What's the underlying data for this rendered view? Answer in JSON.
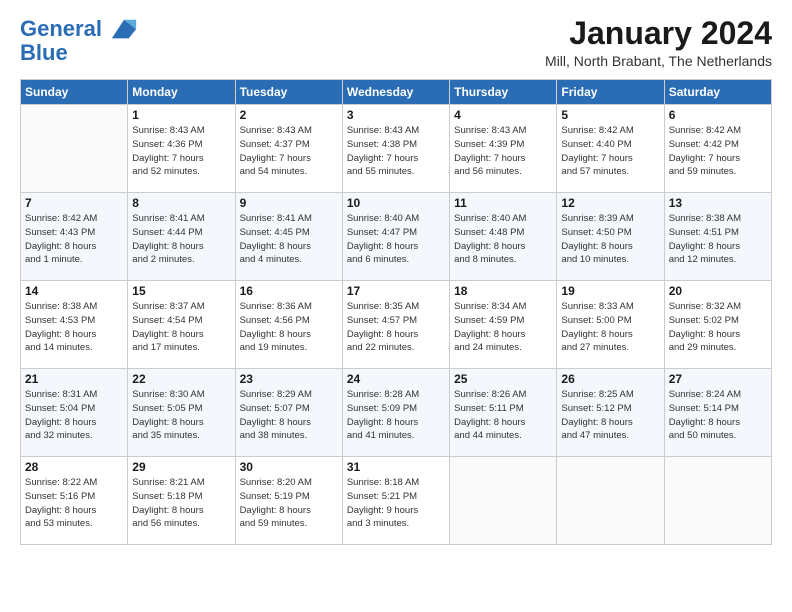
{
  "header": {
    "logo_line1": "General",
    "logo_line2": "Blue",
    "month": "January 2024",
    "location": "Mill, North Brabant, The Netherlands"
  },
  "days_of_week": [
    "Sunday",
    "Monday",
    "Tuesday",
    "Wednesday",
    "Thursday",
    "Friday",
    "Saturday"
  ],
  "weeks": [
    [
      {
        "day": "",
        "info": ""
      },
      {
        "day": "1",
        "info": "Sunrise: 8:43 AM\nSunset: 4:36 PM\nDaylight: 7 hours\nand 52 minutes."
      },
      {
        "day": "2",
        "info": "Sunrise: 8:43 AM\nSunset: 4:37 PM\nDaylight: 7 hours\nand 54 minutes."
      },
      {
        "day": "3",
        "info": "Sunrise: 8:43 AM\nSunset: 4:38 PM\nDaylight: 7 hours\nand 55 minutes."
      },
      {
        "day": "4",
        "info": "Sunrise: 8:43 AM\nSunset: 4:39 PM\nDaylight: 7 hours\nand 56 minutes."
      },
      {
        "day": "5",
        "info": "Sunrise: 8:42 AM\nSunset: 4:40 PM\nDaylight: 7 hours\nand 57 minutes."
      },
      {
        "day": "6",
        "info": "Sunrise: 8:42 AM\nSunset: 4:42 PM\nDaylight: 7 hours\nand 59 minutes."
      }
    ],
    [
      {
        "day": "7",
        "info": "Sunrise: 8:42 AM\nSunset: 4:43 PM\nDaylight: 8 hours\nand 1 minute."
      },
      {
        "day": "8",
        "info": "Sunrise: 8:41 AM\nSunset: 4:44 PM\nDaylight: 8 hours\nand 2 minutes."
      },
      {
        "day": "9",
        "info": "Sunrise: 8:41 AM\nSunset: 4:45 PM\nDaylight: 8 hours\nand 4 minutes."
      },
      {
        "day": "10",
        "info": "Sunrise: 8:40 AM\nSunset: 4:47 PM\nDaylight: 8 hours\nand 6 minutes."
      },
      {
        "day": "11",
        "info": "Sunrise: 8:40 AM\nSunset: 4:48 PM\nDaylight: 8 hours\nand 8 minutes."
      },
      {
        "day": "12",
        "info": "Sunrise: 8:39 AM\nSunset: 4:50 PM\nDaylight: 8 hours\nand 10 minutes."
      },
      {
        "day": "13",
        "info": "Sunrise: 8:38 AM\nSunset: 4:51 PM\nDaylight: 8 hours\nand 12 minutes."
      }
    ],
    [
      {
        "day": "14",
        "info": "Sunrise: 8:38 AM\nSunset: 4:53 PM\nDaylight: 8 hours\nand 14 minutes."
      },
      {
        "day": "15",
        "info": "Sunrise: 8:37 AM\nSunset: 4:54 PM\nDaylight: 8 hours\nand 17 minutes."
      },
      {
        "day": "16",
        "info": "Sunrise: 8:36 AM\nSunset: 4:56 PM\nDaylight: 8 hours\nand 19 minutes."
      },
      {
        "day": "17",
        "info": "Sunrise: 8:35 AM\nSunset: 4:57 PM\nDaylight: 8 hours\nand 22 minutes."
      },
      {
        "day": "18",
        "info": "Sunrise: 8:34 AM\nSunset: 4:59 PM\nDaylight: 8 hours\nand 24 minutes."
      },
      {
        "day": "19",
        "info": "Sunrise: 8:33 AM\nSunset: 5:00 PM\nDaylight: 8 hours\nand 27 minutes."
      },
      {
        "day": "20",
        "info": "Sunrise: 8:32 AM\nSunset: 5:02 PM\nDaylight: 8 hours\nand 29 minutes."
      }
    ],
    [
      {
        "day": "21",
        "info": "Sunrise: 8:31 AM\nSunset: 5:04 PM\nDaylight: 8 hours\nand 32 minutes."
      },
      {
        "day": "22",
        "info": "Sunrise: 8:30 AM\nSunset: 5:05 PM\nDaylight: 8 hours\nand 35 minutes."
      },
      {
        "day": "23",
        "info": "Sunrise: 8:29 AM\nSunset: 5:07 PM\nDaylight: 8 hours\nand 38 minutes."
      },
      {
        "day": "24",
        "info": "Sunrise: 8:28 AM\nSunset: 5:09 PM\nDaylight: 8 hours\nand 41 minutes."
      },
      {
        "day": "25",
        "info": "Sunrise: 8:26 AM\nSunset: 5:11 PM\nDaylight: 8 hours\nand 44 minutes."
      },
      {
        "day": "26",
        "info": "Sunrise: 8:25 AM\nSunset: 5:12 PM\nDaylight: 8 hours\nand 47 minutes."
      },
      {
        "day": "27",
        "info": "Sunrise: 8:24 AM\nSunset: 5:14 PM\nDaylight: 8 hours\nand 50 minutes."
      }
    ],
    [
      {
        "day": "28",
        "info": "Sunrise: 8:22 AM\nSunset: 5:16 PM\nDaylight: 8 hours\nand 53 minutes."
      },
      {
        "day": "29",
        "info": "Sunrise: 8:21 AM\nSunset: 5:18 PM\nDaylight: 8 hours\nand 56 minutes."
      },
      {
        "day": "30",
        "info": "Sunrise: 8:20 AM\nSunset: 5:19 PM\nDaylight: 8 hours\nand 59 minutes."
      },
      {
        "day": "31",
        "info": "Sunrise: 8:18 AM\nSunset: 5:21 PM\nDaylight: 9 hours\nand 3 minutes."
      },
      {
        "day": "",
        "info": ""
      },
      {
        "day": "",
        "info": ""
      },
      {
        "day": "",
        "info": ""
      }
    ]
  ]
}
